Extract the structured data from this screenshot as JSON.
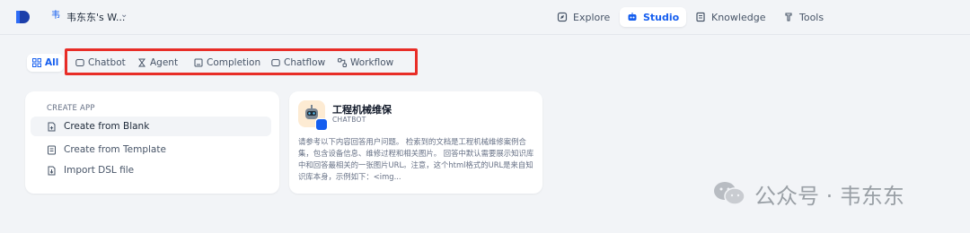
{
  "workspace": {
    "name": "韦东东's W...",
    "icon_glyph": "韦"
  },
  "nav": [
    {
      "label": "Explore",
      "icon": "compass-icon",
      "active": false
    },
    {
      "label": "Studio",
      "icon": "robot-icon",
      "active": true
    },
    {
      "label": "Knowledge",
      "icon": "book-icon",
      "active": false
    },
    {
      "label": "Tools",
      "icon": "wrench-icon",
      "active": false
    }
  ],
  "filter_tabs": [
    {
      "label": "All",
      "icon": "grid-icon",
      "active": true
    },
    {
      "label": "Chatbot",
      "icon": "chat-icon",
      "active": false
    },
    {
      "label": "Agent",
      "icon": "agent-icon",
      "active": false
    },
    {
      "label": "Completion",
      "icon": "document-icon",
      "active": false
    },
    {
      "label": "Chatflow",
      "icon": "chat-icon",
      "active": false
    },
    {
      "label": "Workflow",
      "icon": "workflow-icon",
      "active": false
    }
  ],
  "create_app": {
    "title": "CREATE APP",
    "items": [
      {
        "label": "Create from Blank",
        "icon": "file-plus-icon"
      },
      {
        "label": "Create from Template",
        "icon": "template-icon"
      },
      {
        "label": "Import DSL file",
        "icon": "import-icon"
      }
    ]
  },
  "app_card": {
    "name": "工程机械维保",
    "type": "CHATBOT",
    "description": "请参考以下内容回答用户问题。 检索到的文档是工程机械维修案例合集，包含设备信息、维修过程和相关图片。 回答中默认需要展示知识库中和回答最相关的一张图片URL。注意，这个html格式的URL是来自知识库本身，示例如下：<img..."
  },
  "watermark": {
    "text": "公众号 · 韦东东"
  },
  "colors": {
    "accent": "#155eef",
    "highlight_border": "#e82d27",
    "background": "#f2f4f7"
  }
}
